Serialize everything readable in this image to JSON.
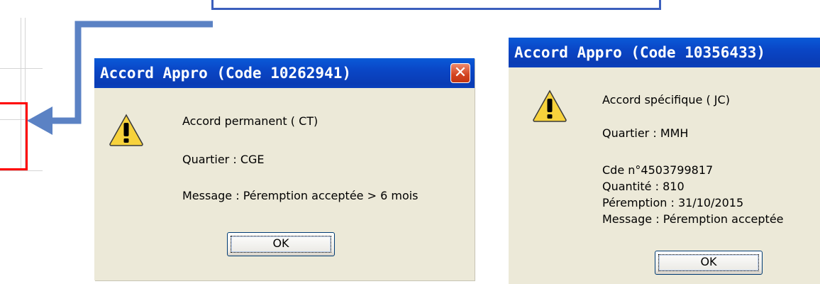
{
  "dialogs": [
    {
      "title": "Accord Appro (Code 10262941)",
      "close_glyph": "✕",
      "icon": "warning-icon",
      "lines": [
        "Accord permanent ( CT)",
        "Quartier : CGE",
        "Message : Péremption acceptée > 6 mois"
      ],
      "ok_label": "OK"
    },
    {
      "title": "Accord Appro (Code 10356433)",
      "icon": "warning-icon",
      "lines": [
        "Accord spécifique ( JC)",
        "Quartier : MMH",
        "Cde n°4503799817",
        "Quantité : 810",
        "Péremption : 31/10/2015",
        "Message : Péremption acceptée"
      ],
      "ok_label": "OK"
    }
  ],
  "colors": {
    "callout_border": "#3b5fbd",
    "arrow": "#5b82c4",
    "highlight": "#ff0000",
    "dialog_bg": "#ece9d8",
    "titlebar": "#0a46c6"
  }
}
